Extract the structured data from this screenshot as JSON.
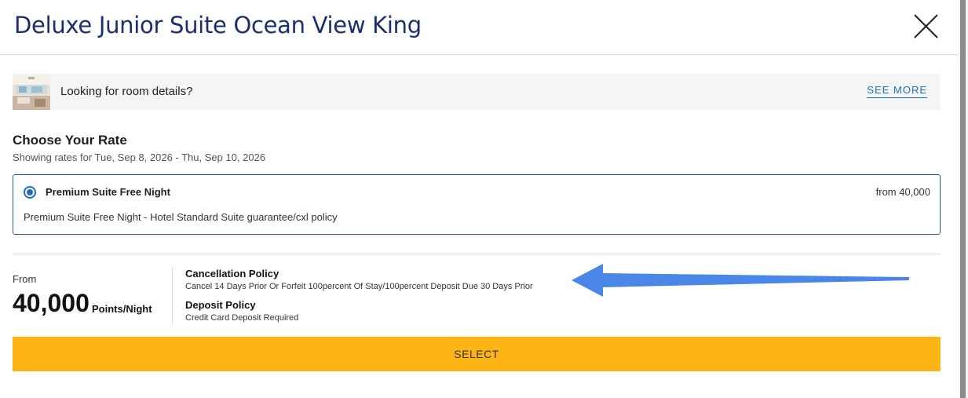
{
  "header": {
    "title": "Deluxe Junior Suite Ocean View King",
    "close_icon": "close-icon"
  },
  "room_details": {
    "thumbnail_icon": "room-photo",
    "text": "Looking for room details?",
    "link_label": "SEE MORE"
  },
  "rates": {
    "heading": "Choose Your Rate",
    "date_range": "Showing rates for Tue, Sep 8, 2026 - Thu, Sep 10, 2026",
    "options": [
      {
        "name": "Premium Suite Free Night",
        "price": "from 40,000",
        "description": "Premium Suite Free Night - Hotel Standard Suite guarantee/cxl policy",
        "selected": true
      }
    ]
  },
  "summary": {
    "from_label": "From",
    "points": "40,000",
    "points_unit": "Points/Night",
    "cancellation_heading": "Cancellation Policy",
    "cancellation_text": "Cancel 14 Days Prior Or Forfeit 100percent Of Stay/100percent Deposit Due 30 Days Prior",
    "deposit_heading": "Deposit Policy",
    "deposit_text": "Credit Card Deposit Required"
  },
  "actions": {
    "select_label": "SELECT"
  },
  "colors": {
    "title": "#1c2e6e",
    "link": "#1e6fb8",
    "select_button": "#fdb515",
    "annotation_arrow": "#4a86e8"
  }
}
